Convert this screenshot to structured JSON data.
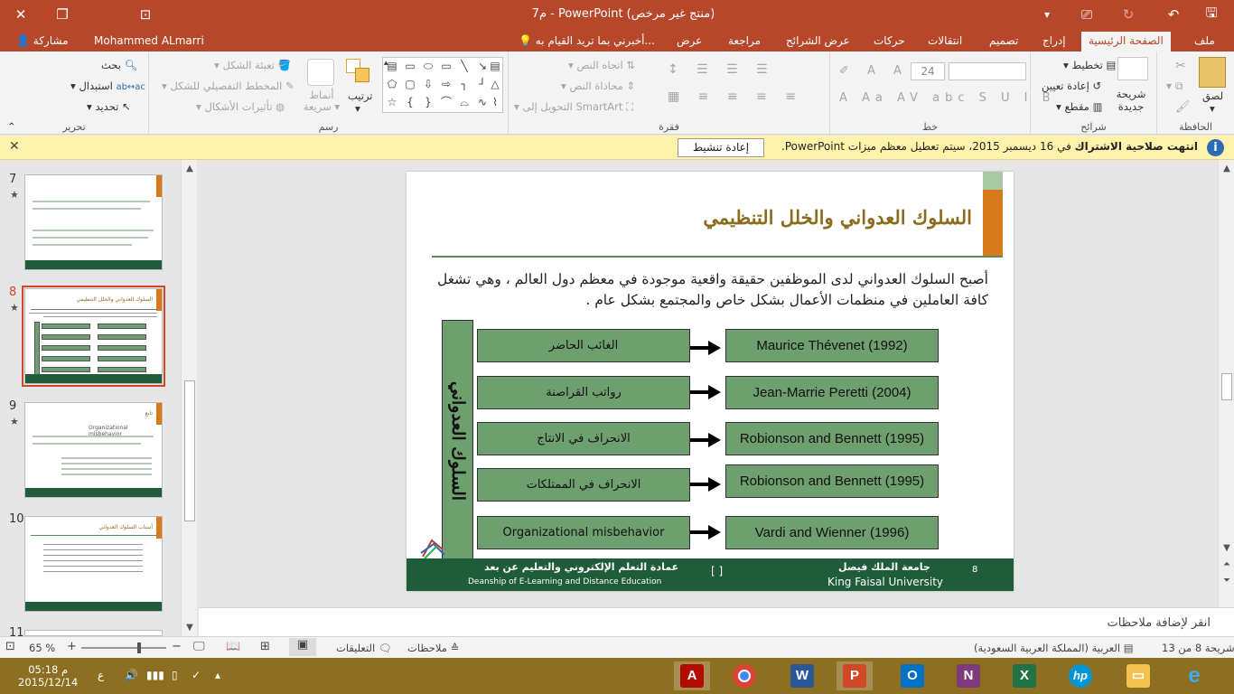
{
  "window": {
    "title": "م7 - PowerPoint (منتج غير مرخص)"
  },
  "tabs": [
    {
      "label": "ملف"
    },
    {
      "label": "الصفحة الرئيسية",
      "active": true
    },
    {
      "label": "إدراج"
    },
    {
      "label": "تصميم"
    },
    {
      "label": "انتقالات"
    },
    {
      "label": "حركات"
    },
    {
      "label": "عرض الشرائح"
    },
    {
      "label": "مراجعة"
    },
    {
      "label": "عرض"
    }
  ],
  "tell_me": "أخبرني بما تريد القيام به...",
  "user_name": "Mohammed ALmarri",
  "share_label": "مشاركة",
  "ribbon": {
    "clipboard": {
      "label": "الحافظة",
      "paste": "لصق"
    },
    "slides": {
      "label": "شرائح",
      "new_slide": "شريحة جديدة",
      "layout": "تخطيط",
      "reset": "إعادة تعيين",
      "section": "مقطع"
    },
    "font": {
      "label": "خط",
      "size": "24"
    },
    "paragraph": {
      "label": "فقرة",
      "text_direction": "اتجاه النص",
      "align_text": "محاذاة النص",
      "smartart": "التحويل إلى SmartArt"
    },
    "drawing": {
      "label": "رسم",
      "arrange": "ترتيب",
      "quick_styles": "أنماط سريعة",
      "shape_fill": "تعبئة الشكل",
      "shape_outline": "المخطط التفصيلي للشكل",
      "shape_effects": "تأثيرات الأشكال"
    },
    "editing": {
      "label": "تحرير",
      "find": "بحث",
      "replace": "استبدال",
      "select": "تحديد"
    }
  },
  "infobar": {
    "bold": "انتهت صلاحية الاشتراك",
    "message": "في  16 ديسمبر 2015، سيتم تعطيل معظم ميزات PowerPoint.",
    "button": "إعادة تنشيط"
  },
  "thumbnails": [
    {
      "number": "7",
      "star": "★"
    },
    {
      "number": "8",
      "star": "★",
      "selected": true
    },
    {
      "number": "9",
      "star": "★"
    },
    {
      "number": "10",
      "star": ""
    },
    {
      "number": "11",
      "star": ""
    }
  ],
  "thumb_text": {
    "slide8_title": "السلوك العدواني والخلل التنظيمي",
    "slide9_title": "تابع",
    "slide9_sub": "Organizational misbehavior",
    "slide10_title": "أسباب السلوك العدواني"
  },
  "slide": {
    "title": "السلوك العدواني والخلل التنظيمي",
    "body": "أصبح السلوك العدواني لدى الموظفين حقيقة واقعية موجودة في معظم دول العالم ، وهي تشغل كافة العاملين في منظمات الأعمال بشكل خاص والمجتمع بشكل عام .",
    "side_label": "السلوك العدواني",
    "rows": [
      {
        "left": "الغائب الحاضر",
        "right": "Maurice Thévenet (1992)"
      },
      {
        "left": "رواتب القراصنة",
        "right": "Jean-Marrie Peretti (2004)"
      },
      {
        "left": "الانحراف في الانتاج",
        "right": "Robionson and Bennett (1995)"
      },
      {
        "left": "الانحراف في الممتلكات",
        "right": "Robionson and Bennett (1995)"
      },
      {
        "left": "Organizational misbehavior",
        "right": "Vardi and Wienner (1996)"
      }
    ],
    "footer": {
      "deanship_ar": "عمادة التعلم الإلكتروني والتعليم عن بعد",
      "deanship_en": "Deanship of E-Learning and Distance Education",
      "brackets": "[     ]",
      "university_ar": "جامعة الملك فيصل",
      "university_en": "King Faisal University",
      "page": "8"
    }
  },
  "notes_placeholder": "انقر لإضافة ملاحظات",
  "status": {
    "slide_of": "شريحة 8 من 13",
    "language": "العربية (المملكة العربية السعودية)",
    "notes": "ملاحظات",
    "comments": "التعليقات",
    "zoom": "65 %"
  },
  "taskbar": {
    "time": "05:18 م",
    "date": "2015/12/14",
    "lang": "ع"
  },
  "colors": {
    "brand": "#b7472a",
    "slide_green": "#6e9f6e",
    "footer_green": "#1e5c3a",
    "title_gold": "#8a6d1c",
    "accent_orange": "#d87a1c"
  }
}
